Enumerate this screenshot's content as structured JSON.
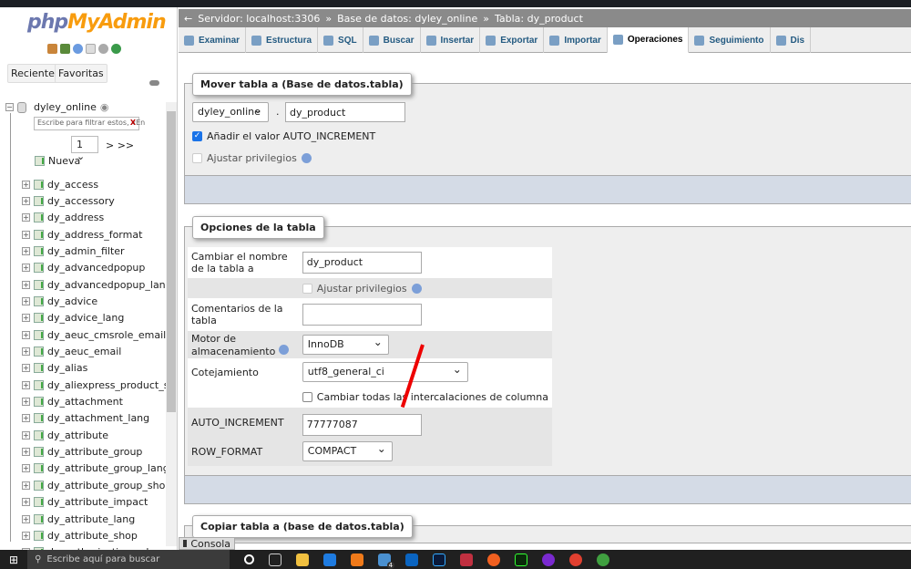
{
  "sidebar": {
    "logo": "phpMyAdmin",
    "recent": "Reciente",
    "favorites": "Favoritas",
    "database": "dyley_online",
    "filter_placeholder": "Escribe para filtrar estos, «En",
    "filter_clear": "X",
    "page": "1",
    "page_nav": "> >>",
    "new_label": "Nueva",
    "tables": [
      "dy_access",
      "dy_accessory",
      "dy_address",
      "dy_address_format",
      "dy_admin_filter",
      "dy_advancedpopup",
      "dy_advancedpopup_lang",
      "dy_advice",
      "dy_advice_lang",
      "dy_aeuc_cmsrole_email",
      "dy_aeuc_email",
      "dy_alias",
      "dy_aliexpress_product_sku",
      "dy_attachment",
      "dy_attachment_lang",
      "dy_attribute",
      "dy_attribute_group",
      "dy_attribute_group_lang",
      "dy_attribute_group_shop",
      "dy_attribute_impact",
      "dy_attribute_lang",
      "dy_attribute_shop",
      "dy_authorization_role"
    ]
  },
  "breadcrumb": {
    "server": "Servidor: localhost:3306",
    "sep": "»",
    "database": "Base de datos: dyley_online",
    "table": "Tabla: dy_product"
  },
  "tabs": [
    {
      "label": "Examinar"
    },
    {
      "label": "Estructura"
    },
    {
      "label": "SQL"
    },
    {
      "label": "Buscar"
    },
    {
      "label": "Insertar"
    },
    {
      "label": "Exportar"
    },
    {
      "label": "Importar"
    },
    {
      "label": "Operaciones",
      "active": true
    },
    {
      "label": "Seguimiento"
    },
    {
      "label": "Dis"
    }
  ],
  "move": {
    "legend": "Mover tabla a (Base de datos.tabla)",
    "db": "dyley_online",
    "dot": ".",
    "table": "dy_product",
    "auto_increment": "Añadir el valor AUTO_INCREMENT",
    "auto_increment_checked": true,
    "privileges": "Ajustar privilegios"
  },
  "options": {
    "legend": "Opciones de la tabla",
    "rename_label": "Cambiar el nombre de la tabla a",
    "rename_value": "dy_product",
    "privileges": "Ajustar privilegios",
    "comments_label": "Comentarios de la tabla",
    "comments_value": "",
    "engine_label": "Motor de almacenamiento",
    "engine": "InnoDB",
    "collation_label": "Cotejamiento",
    "collation": "utf8_general_ci",
    "change_all": "Cambiar todas las intercalaciones de columna",
    "auto_increment_label": "AUTO_INCREMENT",
    "auto_increment_value": "77777087",
    "row_format_label": "ROW_FORMAT",
    "row_format": "COMPACT"
  },
  "copy": {
    "legend": "Copiar tabla a (base de datos.tabla)"
  },
  "console": "Consola",
  "taskbar": {
    "search": "Escribe aquí para buscar",
    "mail_badge": "4"
  },
  "colors": {
    "annotation_arrow": "#e00000",
    "tab_link": "#235a81",
    "breadcrumb_bg": "#8a8a8a"
  }
}
